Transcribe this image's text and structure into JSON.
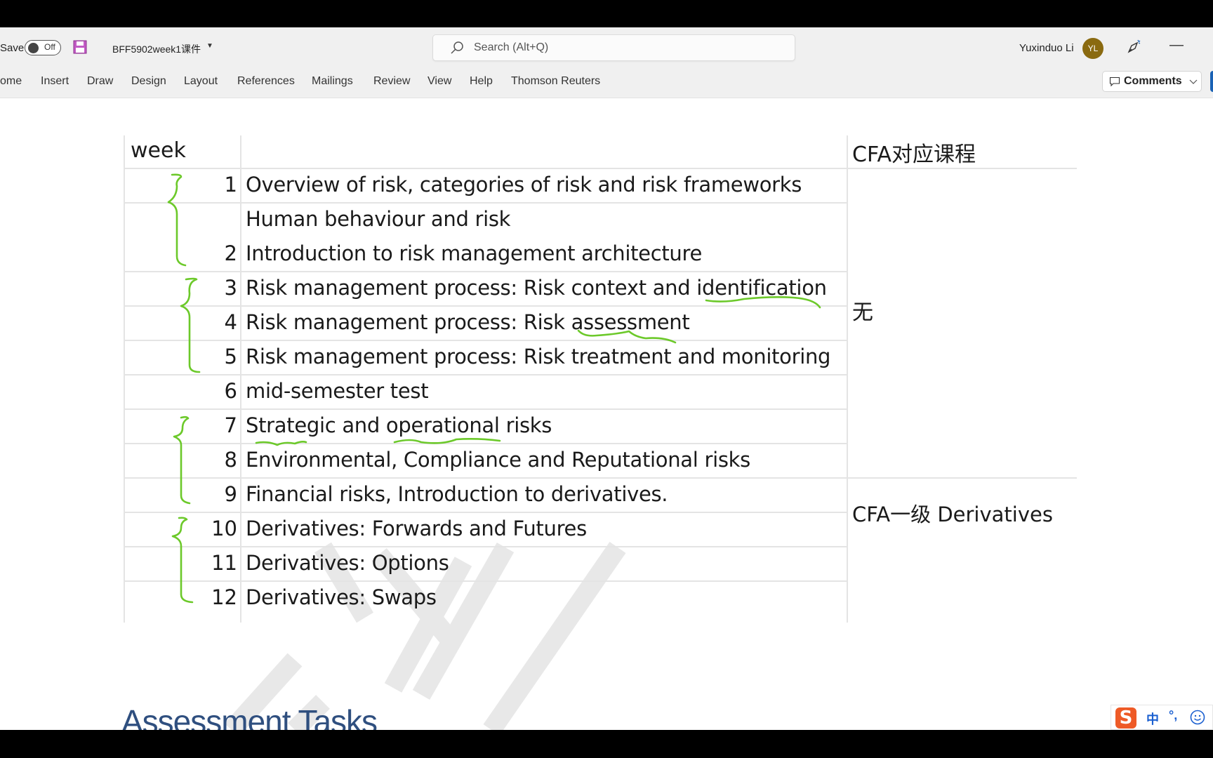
{
  "titlebar": {
    "autosave_label": "Save",
    "autosave_state": "Off",
    "document_title": "BFF5902week1课件",
    "search_placeholder": "Search (Alt+Q)",
    "search_value": "",
    "user_name": "Yuxinduo Li",
    "user_initials": "YL",
    "avatar_color": "#8a6a10",
    "minimize_symbol": "—"
  },
  "ribbon": {
    "tabs": [
      {
        "label": "ome"
      },
      {
        "label": "Insert"
      },
      {
        "label": "Draw"
      },
      {
        "label": "Design"
      },
      {
        "label": "Layout"
      },
      {
        "label": "References"
      },
      {
        "label": "Mailings"
      },
      {
        "label": "Review"
      },
      {
        "label": "View"
      },
      {
        "label": "Help"
      },
      {
        "label": "Thomson Reuters"
      }
    ],
    "comments_label": "Comments"
  },
  "table": {
    "header_week": "week",
    "header_topic": "",
    "header_cfa": "CFA对应课程",
    "rows": [
      {
        "week": "1",
        "topic": "Overview of risk, categories of risk and risk frameworks"
      },
      {
        "week": "",
        "topic": "Human behaviour and risk"
      },
      {
        "week": "2",
        "topic": "Introduction to risk management architecture"
      },
      {
        "week": "3",
        "topic": "Risk management process: Risk context and identification"
      },
      {
        "week": "4",
        "topic": "Risk management process: Risk assessment"
      },
      {
        "week": "5",
        "topic": "Risk management process: Risk treatment and monitoring"
      },
      {
        "week": "6",
        "topic": "mid-semester test"
      },
      {
        "week": "7",
        "topic": "Strategic and operational risks"
      },
      {
        "week": "8",
        "topic": "Environmental, Compliance and Reputational risks"
      },
      {
        "week": "9",
        "topic": "Financial risks, Introduction to derivatives."
      },
      {
        "week": "10",
        "topic": "Derivatives: Forwards and Futures"
      },
      {
        "week": "11",
        "topic": "Derivatives: Options"
      },
      {
        "week": "12",
        "topic": "Derivatives: Swaps"
      }
    ],
    "cfa_groups": [
      {
        "label": "无",
        "rows": "1-9"
      },
      {
        "label": "CFA一级 Derivatives",
        "rows": "10-12"
      }
    ]
  },
  "annotations": {
    "color": "#6cc92a",
    "brackets": [
      "weeks 1-2",
      "weeks 3-5",
      "weeks 7-9",
      "weeks 10-12"
    ],
    "underlines": [
      "identification",
      "assessment",
      "Strategic",
      "operational"
    ]
  },
  "document": {
    "heading": "Assessment Tasks"
  },
  "ime": {
    "logo": "S",
    "mode": "中",
    "punct": "°,"
  }
}
